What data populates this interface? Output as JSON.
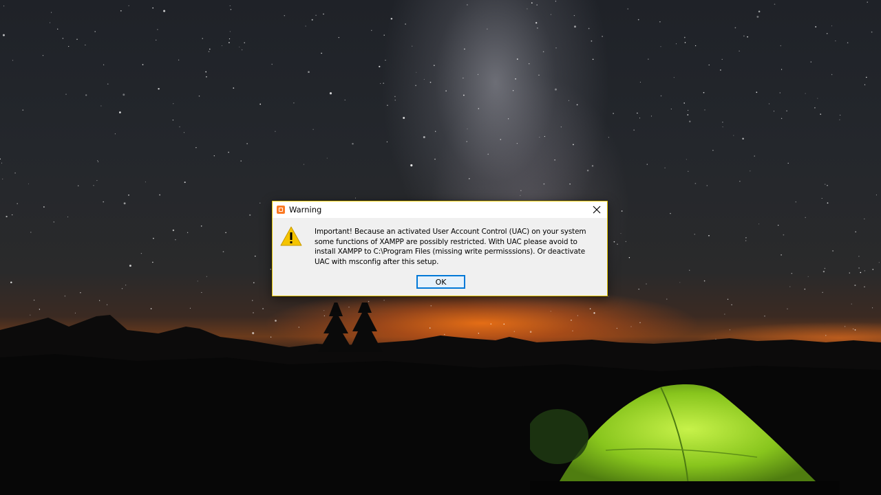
{
  "dialog": {
    "title": "Warning",
    "app_icon": "xampp-icon",
    "close_icon": "close-icon",
    "warning_icon": "warning-triangle-icon",
    "message_lines": [
      "Important! Because an activated User Account Control (UAC) on your system",
      "some functions of XAMPP are possibly restricted. With UAC please avoid to",
      "install XAMPP to C:\\Program Files (missing write permisssions). Or deactivate",
      "UAC with msconfig after this setup."
    ],
    "ok_label": "OK"
  },
  "colors": {
    "accent_border": "#e3c400",
    "button_focus": "#0078d7",
    "warning_yellow": "#f5c400",
    "xampp_orange": "#fb7a24"
  },
  "wallpaper": "night sky with milky way, mountains and glowing green tent"
}
